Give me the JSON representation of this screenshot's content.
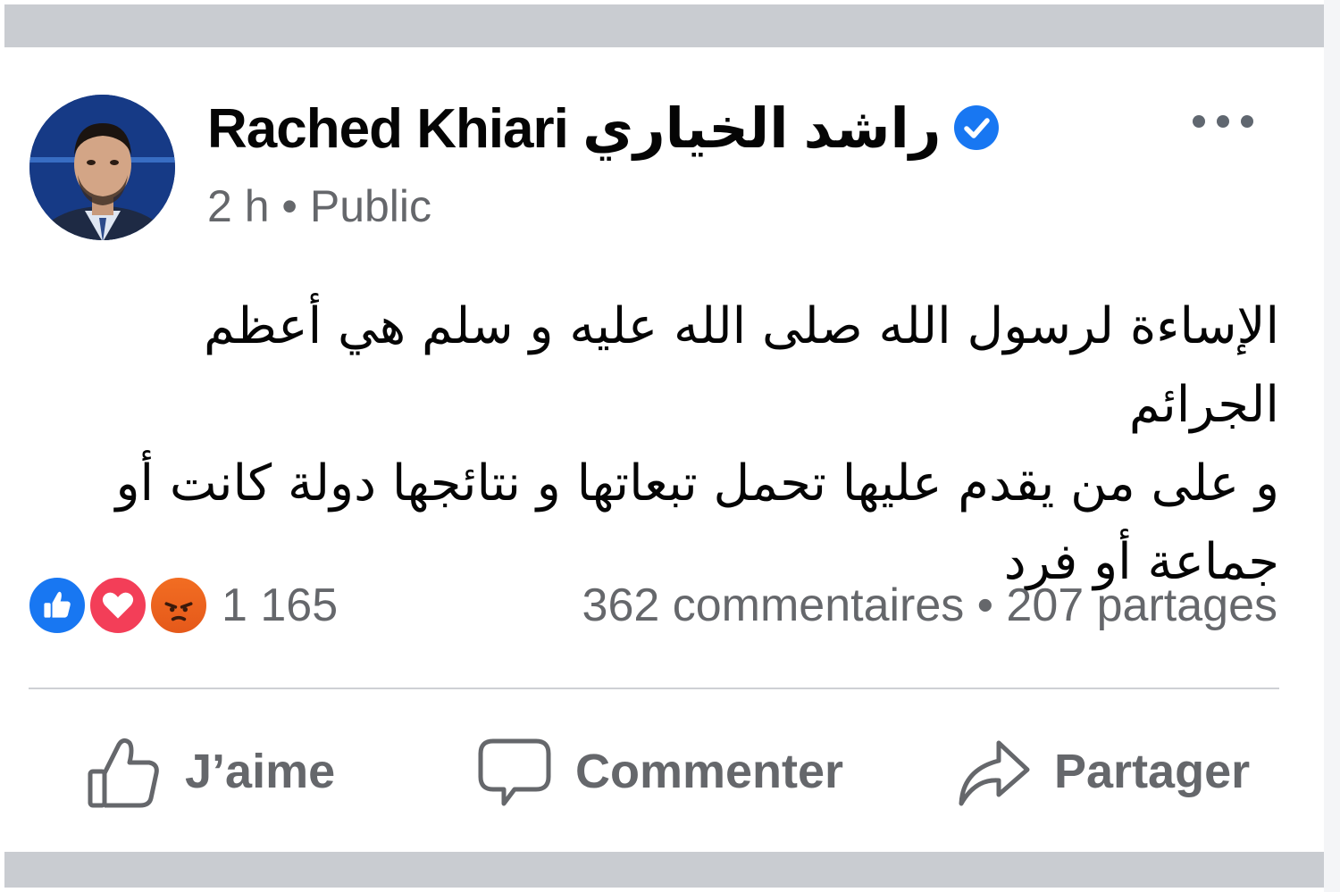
{
  "post": {
    "author": "Rached Khiari راشد الخياري",
    "time": "2 h",
    "separator": "•",
    "visibility": "Public",
    "lines": [
      "الإساءة لرسول الله صلى الله عليه و سلم هي أعظم الجرائم",
      "و على من يقدم عليها تحمل تبعاتها و نتائجها دولة كانت أو",
      "جماعة أو فرد"
    ]
  },
  "engagement": {
    "reactions": [
      "like-icon",
      "love-icon",
      "angry-icon"
    ],
    "reaction_count": "1 165",
    "comments": "362 commentaires",
    "dot": "•",
    "shares": "207 partages"
  },
  "actions": {
    "like": "J’aime",
    "comment": "Commenter",
    "share": "Partager"
  },
  "colors": {
    "verified": "#1877f2",
    "like": "#1877f2",
    "love": "#f33e58",
    "angry": "#f26d22",
    "secondary_text": "#65676b"
  }
}
